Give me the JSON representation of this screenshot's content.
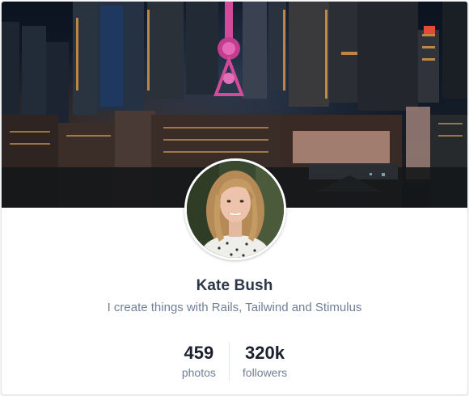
{
  "profile": {
    "name": "Kate Bush",
    "bio": "I create things with Rails, Tailwind and Stimulus"
  },
  "stats": [
    {
      "value": "459",
      "label": "photos"
    },
    {
      "value": "320k",
      "label": "followers"
    }
  ],
  "colors": {
    "name_text": "#2d3748",
    "muted_text": "#718096",
    "divider": "#e2e8f0",
    "card_bg": "#ffffff"
  },
  "images": {
    "cover": "city-night-skyline",
    "avatar": "portrait-photo"
  }
}
